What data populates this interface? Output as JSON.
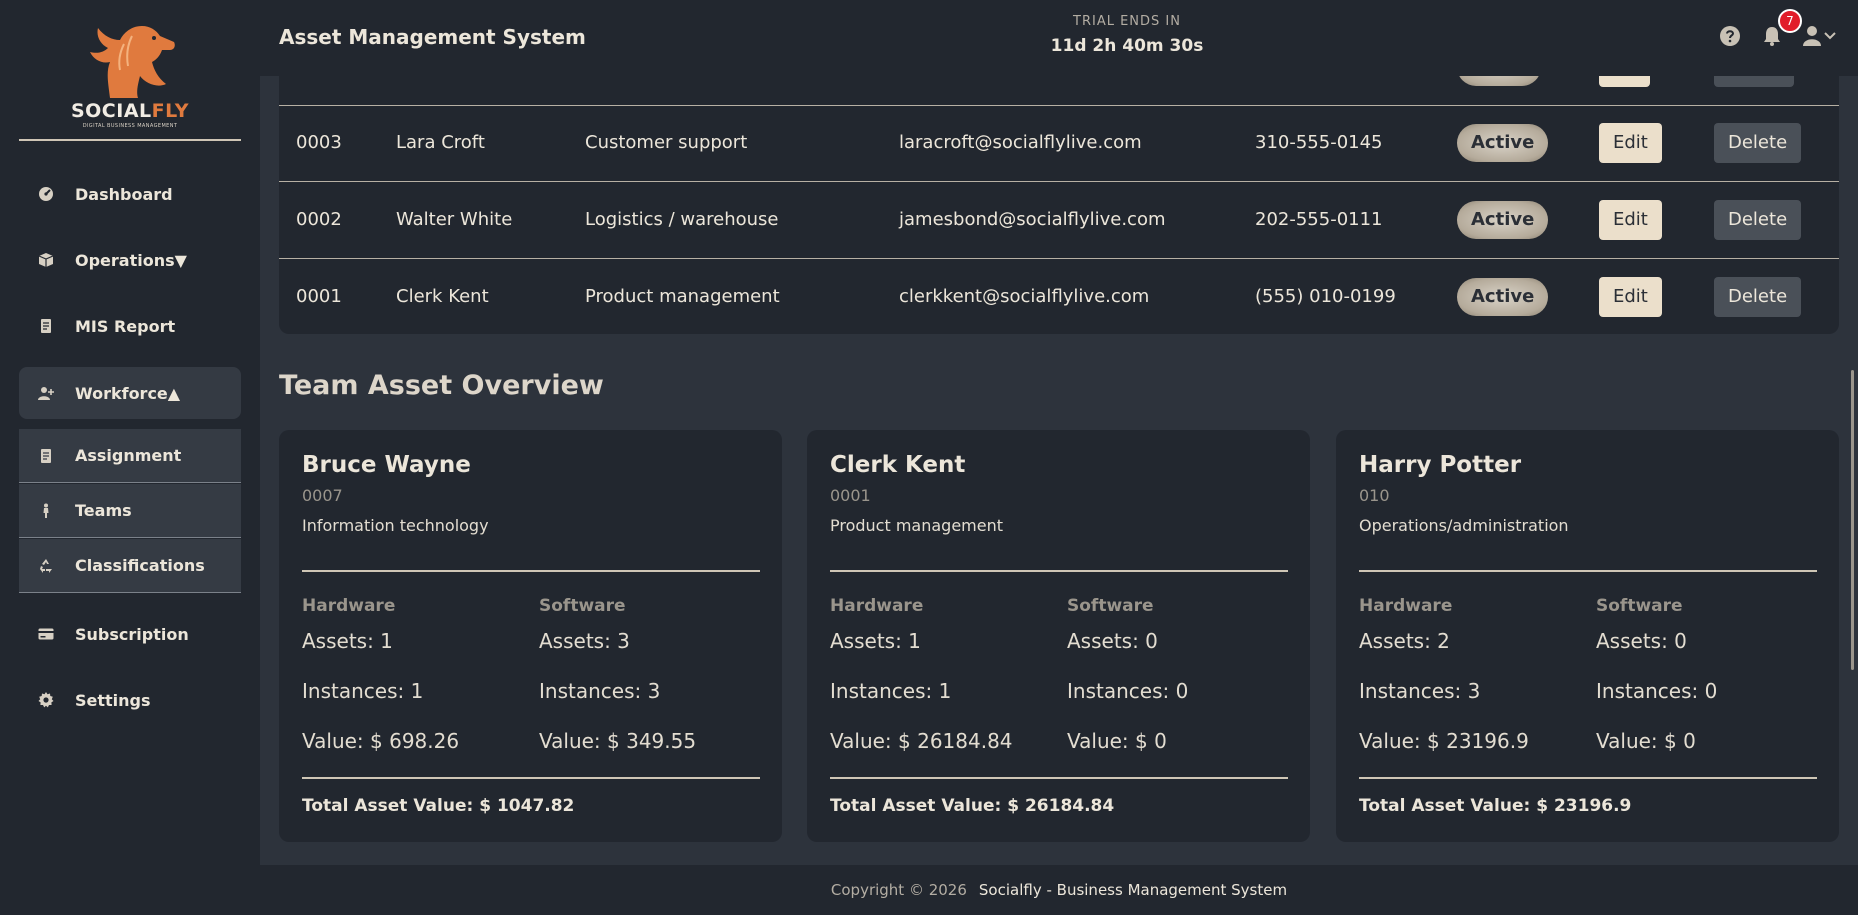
{
  "sidebar": {
    "logo": {
      "name_a": "SOCIAL",
      "name_b": "FLY",
      "tagline": "DIGITAL BUSINESS MANAGEMENT"
    },
    "items": [
      {
        "label": "Dashboard"
      },
      {
        "label": "Operations▼"
      },
      {
        "label": "MIS Report"
      },
      {
        "label": "Workforce▲"
      },
      {
        "label": "Assignment"
      },
      {
        "label": "Teams"
      },
      {
        "label": "Classifications"
      },
      {
        "label": "Subscription"
      },
      {
        "label": "Settings"
      }
    ]
  },
  "header": {
    "title": "Asset Management System",
    "trial_label": "TRIAL ENDS IN",
    "trial_time": "11d 2h 40m 30s",
    "notification_count": "7"
  },
  "table": {
    "rows": [
      {
        "id": "0003",
        "name": "Lara Croft",
        "dept": "Customer support",
        "email": "laracroft@socialflylive.com",
        "phone": "310-555-0145",
        "status": "Active",
        "edit": "Edit",
        "delete": "Delete"
      },
      {
        "id": "0002",
        "name": "Walter White",
        "dept": "Logistics / warehouse",
        "email": "jamesbond@socialflylive.com",
        "phone": "202-555-0111",
        "status": "Active",
        "edit": "Edit",
        "delete": "Delete"
      },
      {
        "id": "0001",
        "name": "Clerk Kent",
        "dept": "Product management",
        "email": "clerkkent@socialflylive.com",
        "phone": "(555) 010-0199",
        "status": "Active",
        "edit": "Edit",
        "delete": "Delete"
      }
    ]
  },
  "overview": {
    "title": "Team Asset Overview",
    "cards": [
      {
        "name": "Bruce Wayne",
        "code": "0007",
        "dept": "Information technology",
        "hw_label": "Hardware",
        "sw_label": "Software",
        "hw_assets": "Assets: 1",
        "hw_instances": "Instances: 1",
        "hw_value": "Value: $ 698.26",
        "sw_assets": "Assets: 3",
        "sw_instances": "Instances: 3",
        "sw_value": "Value: $ 349.55",
        "total": "Total Asset Value: $ 1047.82"
      },
      {
        "name": "Clerk Kent",
        "code": "0001",
        "dept": "Product management",
        "hw_label": "Hardware",
        "sw_label": "Software",
        "hw_assets": "Assets: 1",
        "hw_instances": "Instances: 1",
        "hw_value": "Value: $ 26184.84",
        "sw_assets": "Assets: 0",
        "sw_instances": "Instances: 0",
        "sw_value": "Value: $ 0",
        "total": "Total Asset Value: $ 26184.84"
      },
      {
        "name": "Harry Potter",
        "code": "010",
        "dept": "Operations/administration",
        "hw_label": "Hardware",
        "sw_label": "Software",
        "hw_assets": "Assets: 2",
        "hw_instances": "Instances: 3",
        "hw_value": "Value: $ 23196.9",
        "sw_assets": "Assets: 0",
        "sw_instances": "Instances: 0",
        "sw_value": "Value: $ 0",
        "total": "Total Asset Value: $ 23196.9"
      }
    ]
  },
  "footer": {
    "copyright": "Copyright © 2026",
    "brand": "Socialfly - Business Management System"
  }
}
